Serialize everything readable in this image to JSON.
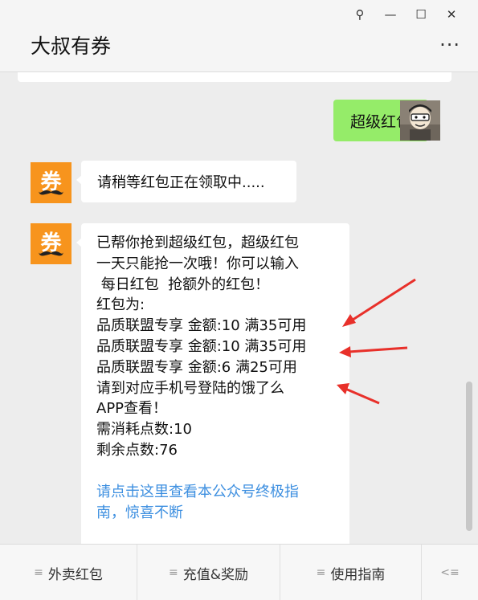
{
  "window": {
    "pin": "⚲",
    "minimize": "—",
    "maximize": "☐",
    "close": "✕"
  },
  "chat": {
    "title": "大叔有券",
    "more": "···"
  },
  "messages": {
    "user_text": "超级红包",
    "bot_avatar_glyph": "券",
    "bot_1": "请稍等红包正在领取中.....",
    "bot_2": {
      "lines": [
        "已帮你抢到超级红包，超级红包",
        "一天只能抢一次哦！你可以输入",
        " 每日红包  抢额外的红包！",
        "红包为:",
        "品质联盟专享 金额:10 满35可用",
        "品质联盟专享 金额:10 满35可用",
        "品质联盟专享 金额:6 满25可用",
        "请到对应手机号登陆的饿了么",
        "APP查看！",
        "需消耗点数:10",
        "剩余点数:76"
      ],
      "link_lines": [
        "请点击这里查看本公众号终极指",
        "南，惊喜不断"
      ]
    }
  },
  "menu": {
    "items": [
      {
        "icon": "≡",
        "label": "外卖红包"
      },
      {
        "icon": "≡",
        "label": "充值&奖励"
      },
      {
        "icon": "≡",
        "label": "使用指南"
      }
    ],
    "keyboard_toggle": "<≡"
  },
  "colors": {
    "accent_green": "#95ec69",
    "avatar_orange": "#f7941d",
    "link_blue": "#3d8fe0",
    "arrow_red": "#e8302a"
  }
}
